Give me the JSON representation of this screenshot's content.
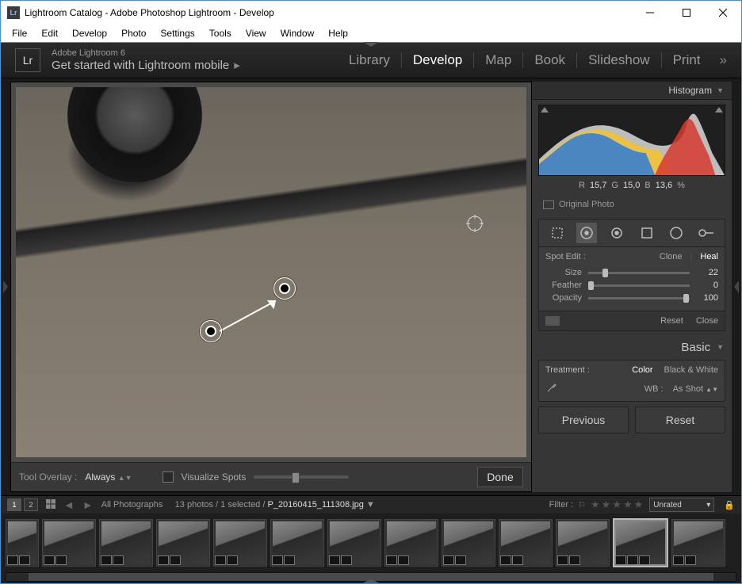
{
  "window": {
    "title": "Lightroom Catalog - Adobe Photoshop Lightroom - Develop",
    "lr_icon": "Lr"
  },
  "menu": [
    "File",
    "Edit",
    "Develop",
    "Photo",
    "Settings",
    "Tools",
    "View",
    "Window",
    "Help"
  ],
  "identity": {
    "lr": "Lr",
    "small": "Adobe Lightroom 6",
    "big": "Get started with Lightroom mobile"
  },
  "modules": {
    "items": [
      "Library",
      "Develop",
      "Map",
      "Book",
      "Slideshow",
      "Print"
    ],
    "active": "Develop",
    "more": "»"
  },
  "toolbar": {
    "overlay_label": "Tool Overlay :",
    "overlay_value": "Always",
    "visualize": "Visualize Spots",
    "done": "Done"
  },
  "right": {
    "histogram": "Histogram",
    "rgb": {
      "r_label": "R",
      "r": "15,7",
      "g_label": "G",
      "g": "15,0",
      "b_label": "B",
      "b": "13,6",
      "pct": "%"
    },
    "original": "Original Photo",
    "spot": {
      "title": "Spot Edit :",
      "clone": "Clone",
      "heal": "Heal",
      "size_label": "Size",
      "size": "22",
      "feather_label": "Feather",
      "feather": "0",
      "opacity_label": "Opacity",
      "opacity": "100",
      "reset": "Reset",
      "close": "Close"
    },
    "basic": {
      "title": "Basic",
      "treatment": "Treatment :",
      "color": "Color",
      "bw": "Black & White",
      "wb_label": "WB :",
      "wb_value": "As Shot"
    },
    "previous": "Previous",
    "reset": "Reset"
  },
  "filmstrip": {
    "pages": [
      "1",
      "2"
    ],
    "collection": "All Photographs",
    "count": "13 photos / 1 selected /",
    "filename": "P_20160415_111308.jpg",
    "filter_label": "Filter :",
    "rated": "Unrated"
  }
}
